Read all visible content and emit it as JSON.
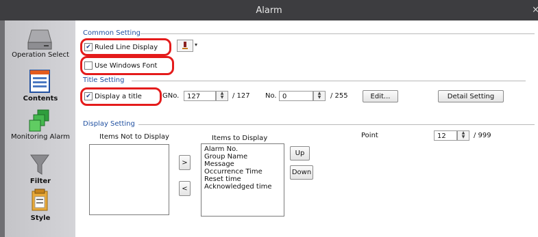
{
  "window": {
    "title": "Alarm",
    "close_glyph": "×"
  },
  "sidebar": {
    "items": [
      {
        "label": "Operation Select",
        "icon": "drive-icon"
      },
      {
        "label": "Contents",
        "icon": "contents-icon"
      },
      {
        "label": "Monitoring Alarm",
        "icon": "monitoring-alarm-icon"
      },
      {
        "label": "Filter",
        "icon": "filter-icon"
      },
      {
        "label": "Style",
        "icon": "style-icon"
      }
    ]
  },
  "common_setting": {
    "title": "Common Setting",
    "ruled_line_display": {
      "label": "Ruled Line Display",
      "checked": true
    },
    "use_windows_font": {
      "label": "Use Windows Font",
      "checked": false
    },
    "color_dropdown_icon": "pen-color-icon"
  },
  "title_setting": {
    "title": "Title Setting",
    "display_a_title": {
      "label": "Display a title",
      "checked": true
    },
    "gno_label": "GNo.",
    "gno_value": "127",
    "gno_max": "/ 127",
    "no_label": "No.",
    "no_value": "0",
    "no_max": "/ 255",
    "edit_button": "Edit...",
    "detail_button": "Detail Setting"
  },
  "display_setting": {
    "title": "Display Setting",
    "not_display_label": "Items Not to Display",
    "display_label": "Items to Display",
    "move_right": ">",
    "move_left": "<",
    "up_button": "Up",
    "down_button": "Down",
    "items_to_display": [
      "Alarm No.",
      "Group Name",
      "Message",
      "Occurrence Time",
      "Reset time",
      "Acknowledged time"
    ],
    "point_label": "Point",
    "point_value": "12",
    "point_max": "/ 999"
  },
  "colors": {
    "section_title": "#1f4fa0",
    "highlight": "#e41b1b",
    "titlebar": "#3d3d40"
  }
}
